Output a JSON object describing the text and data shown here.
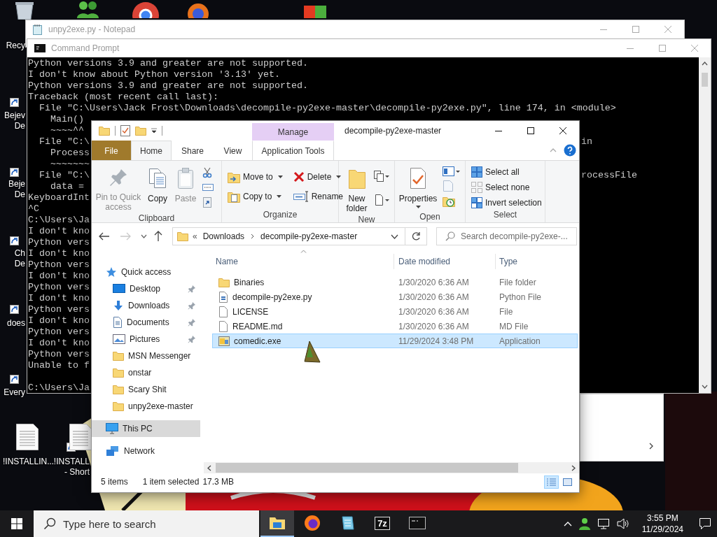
{
  "desktop_icons": [
    {
      "lines": [
        "Recy"
      ]
    },
    {
      "lines": [
        "Bejev",
        "De"
      ]
    },
    {
      "lines": [
        "Beje",
        "De"
      ]
    },
    {
      "lines": [
        "Ch",
        "De"
      ]
    },
    {
      "lines": [
        "does"
      ]
    },
    {
      "lines": [
        "Every"
      ]
    },
    {
      "lines": [
        "!INSTALLIN..."
      ]
    },
    {
      "lines": [
        "!INSTALL",
        "- Short"
      ]
    }
  ],
  "notepad": {
    "title": "unpy2exe.py - Notepad"
  },
  "command_prompt": {
    "title": "Command Prompt",
    "lines": [
      {
        "kind": "text",
        "text": "Python versions 3.9 and greater are not supported."
      },
      {
        "kind": "text",
        "text": "I don't know about Python version '3.13' yet."
      },
      {
        "kind": "text",
        "text": "Python versions 3.9 and greater are not supported."
      },
      {
        "kind": "text",
        "text": "Traceback (most recent call last):"
      },
      {
        "kind": "text",
        "text": "  File \"C:\\Users\\Jack Frost\\Downloads\\decompile-py2exe-master\\decompile-py2exe.py\", line 174, in <module>"
      },
      {
        "kind": "text",
        "text": "    Main()"
      },
      {
        "kind": "text",
        "text": "    ~~~~^^"
      },
      {
        "kind": "text",
        "text": "  File \"C:\\",
        "tail": "in"
      },
      {
        "kind": "text",
        "text": "    Process"
      },
      {
        "kind": "text",
        "text": "    ~~~~~~~"
      },
      {
        "kind": "text",
        "text": "  File \"C:\\",
        "tail": "rocessFile"
      },
      {
        "kind": "text",
        "text": "    data ="
      },
      {
        "kind": "text",
        "text": "KeyboardInt"
      },
      {
        "kind": "text",
        "text": "^C"
      },
      {
        "kind": "text",
        "text": "C:\\Users\\Ja"
      },
      {
        "kind": "text",
        "text": "I don't kno"
      },
      {
        "kind": "text",
        "text": "Python vers"
      },
      {
        "kind": "text",
        "text": "I don't kno"
      },
      {
        "kind": "text",
        "text": "Python vers"
      },
      {
        "kind": "text",
        "text": "I don't kno"
      },
      {
        "kind": "text",
        "text": "Python vers"
      },
      {
        "kind": "text",
        "text": "I don't kno"
      },
      {
        "kind": "text",
        "text": "Python vers"
      },
      {
        "kind": "text",
        "text": "I don't kno"
      },
      {
        "kind": "text",
        "text": "Python vers"
      },
      {
        "kind": "text",
        "text": "I don't kno"
      },
      {
        "kind": "text",
        "text": "Python vers"
      },
      {
        "kind": "text",
        "text": "Unable to f"
      },
      {
        "kind": "blank"
      },
      {
        "kind": "text",
        "text": "C:\\Users\\Ja"
      }
    ]
  },
  "explorer": {
    "title": "decompile-py2exe-master",
    "context_group": "Manage",
    "tabs": [
      {
        "label": "File",
        "kind": "file",
        "selected": false
      },
      {
        "label": "Home",
        "kind": "tab",
        "selected": true
      },
      {
        "label": "Share",
        "kind": "tab",
        "selected": false
      },
      {
        "label": "View",
        "kind": "tab",
        "selected": false
      },
      {
        "label": "Application Tools",
        "kind": "context",
        "selected": false
      }
    ],
    "ribbon_groups": [
      {
        "label": "Clipboard",
        "buttons": [
          {
            "label": "Pin to Quick access",
            "disabled": true
          },
          {
            "label": "Copy",
            "disabled": false
          },
          {
            "label": "Paste",
            "disabled": true
          }
        ]
      },
      {
        "label": "Organize",
        "buttons": [
          {
            "label": "Move to",
            "dropdown": true
          },
          {
            "label": "Delete",
            "dropdown": true
          },
          {
            "label": "Copy to",
            "dropdown": true
          },
          {
            "label": "Rename",
            "dropdown": false
          }
        ]
      },
      {
        "label": "New",
        "buttons": [
          {
            "label": "New folder",
            "dropdown": false
          }
        ]
      },
      {
        "label": "Open",
        "buttons": [
          {
            "label": "Properties",
            "dropdown": true
          }
        ]
      },
      {
        "label": "Select",
        "buttons": [
          {
            "label": "Select all"
          },
          {
            "label": "Select none"
          },
          {
            "label": "Invert selection"
          }
        ]
      }
    ],
    "address": {
      "overflow": "«",
      "path": [
        "Downloads",
        "decompile-py2exe-master"
      ]
    },
    "search": {
      "placeholder": "Search decompile-py2exe-..."
    },
    "nav": [
      {
        "label": "Quick access",
        "selected": false,
        "children": [
          {
            "label": "Desktop",
            "selected": false,
            "pinned": true
          },
          {
            "label": "Downloads",
            "selected": false,
            "pinned": true
          },
          {
            "label": "Documents",
            "selected": false,
            "pinned": true
          },
          {
            "label": "Pictures",
            "selected": false,
            "pinned": true
          },
          {
            "label": "MSN Messenger",
            "selected": false,
            "pinned": false
          },
          {
            "label": "onstar",
            "selected": false,
            "pinned": false
          },
          {
            "label": "Scary Shit",
            "selected": false,
            "pinned": false
          },
          {
            "label": "unpy2exe-master",
            "selected": false,
            "pinned": false
          }
        ]
      },
      {
        "label": "This PC",
        "selected": true
      },
      {
        "label": "Network",
        "selected": false
      }
    ],
    "columns": [
      "Name",
      "Date modified",
      "Type"
    ],
    "files": [
      {
        "name": "Binaries",
        "date": "1/30/2020 6:36 AM",
        "type": "File folder",
        "kind": "folder",
        "selected": false
      },
      {
        "name": "decompile-py2exe.py",
        "date": "1/30/2020 6:36 AM",
        "type": "Python File",
        "kind": "script",
        "selected": false
      },
      {
        "name": "LICENSE",
        "date": "1/30/2020 6:36 AM",
        "type": "File",
        "kind": "file",
        "selected": false
      },
      {
        "name": "README.md",
        "date": "1/30/2020 6:36 AM",
        "type": "MD File",
        "kind": "file",
        "selected": false
      },
      {
        "name": "comedic.exe",
        "date": "11/29/2024 3:48 PM",
        "type": "Application",
        "kind": "app",
        "selected": true
      }
    ],
    "status": {
      "count": "5 items",
      "selection": "1 item selected",
      "size": "17.3 MB"
    },
    "views": [
      {
        "kind": "details",
        "selected": true
      },
      {
        "kind": "large",
        "selected": false
      }
    ]
  },
  "taskbar": {
    "search_placeholder": "Type here to search",
    "apps": [
      {
        "kind": "files",
        "active": true
      },
      {
        "kind": "firefox",
        "active": false
      },
      {
        "kind": "notepad",
        "active": false
      },
      {
        "kind": "archiver",
        "active": false,
        "label": "7z"
      },
      {
        "kind": "terminal",
        "active": false
      }
    ],
    "time": "3:55 PM",
    "date": "11/29/2024"
  }
}
